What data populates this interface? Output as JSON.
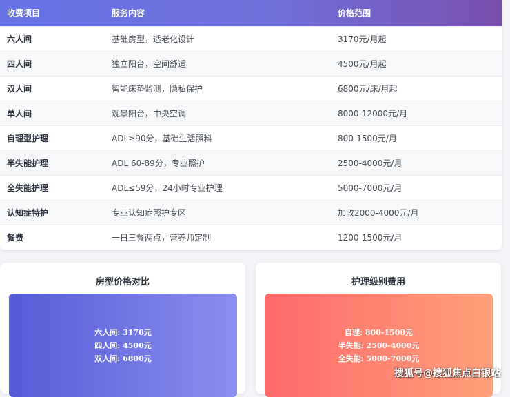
{
  "table": {
    "headers": [
      "收费项目",
      "服务内容",
      "价格范围"
    ],
    "rows": [
      [
        "六人间",
        "基础房型，适老化设计",
        "3170元/月起"
      ],
      [
        "四人间",
        "独立阳台，空间舒适",
        "4500元/月起"
      ],
      [
        "双人间",
        "智能床垫监测，隐私保护",
        "6800元/床/月起"
      ],
      [
        "单人间",
        "观景阳台，中央空调",
        "8000-12000元/月"
      ],
      [
        "自理型护理",
        "ADL≥90分，基础生活照料",
        "800-1500元/月"
      ],
      [
        "半失能护理",
        "ADL 60-89分，专业照护",
        "2500-4000元/月"
      ],
      [
        "全失能护理",
        "ADL≤59分，24小时专业护理",
        "5000-7000元/月"
      ],
      [
        "认知症特护",
        "专业认知症照护专区",
        "加收2000-4000元/月"
      ],
      [
        "餐费",
        "一日三餐两点，营养师定制",
        "1200-1500元/月"
      ]
    ]
  },
  "room_panel": {
    "title": "房型价格对比",
    "lines": [
      "六人间: 3170元",
      "四人间: 4500元",
      "双人间: 6800元"
    ]
  },
  "care_panel": {
    "title": "护理级别费用",
    "lines": [
      "自理: 800-1500元",
      "半失能: 2500-4000元",
      "全失能: 5000-7000元"
    ]
  },
  "watermark": "搜狐号@搜狐焦点白银站",
  "colors": {
    "header_start": "#6673e6",
    "header_end": "#7a4fae",
    "room_box_start": "#555bd6",
    "room_box_end": "#8a8ff0",
    "care_box_start": "#ff6a6a",
    "care_box_end": "#ffa07a"
  }
}
